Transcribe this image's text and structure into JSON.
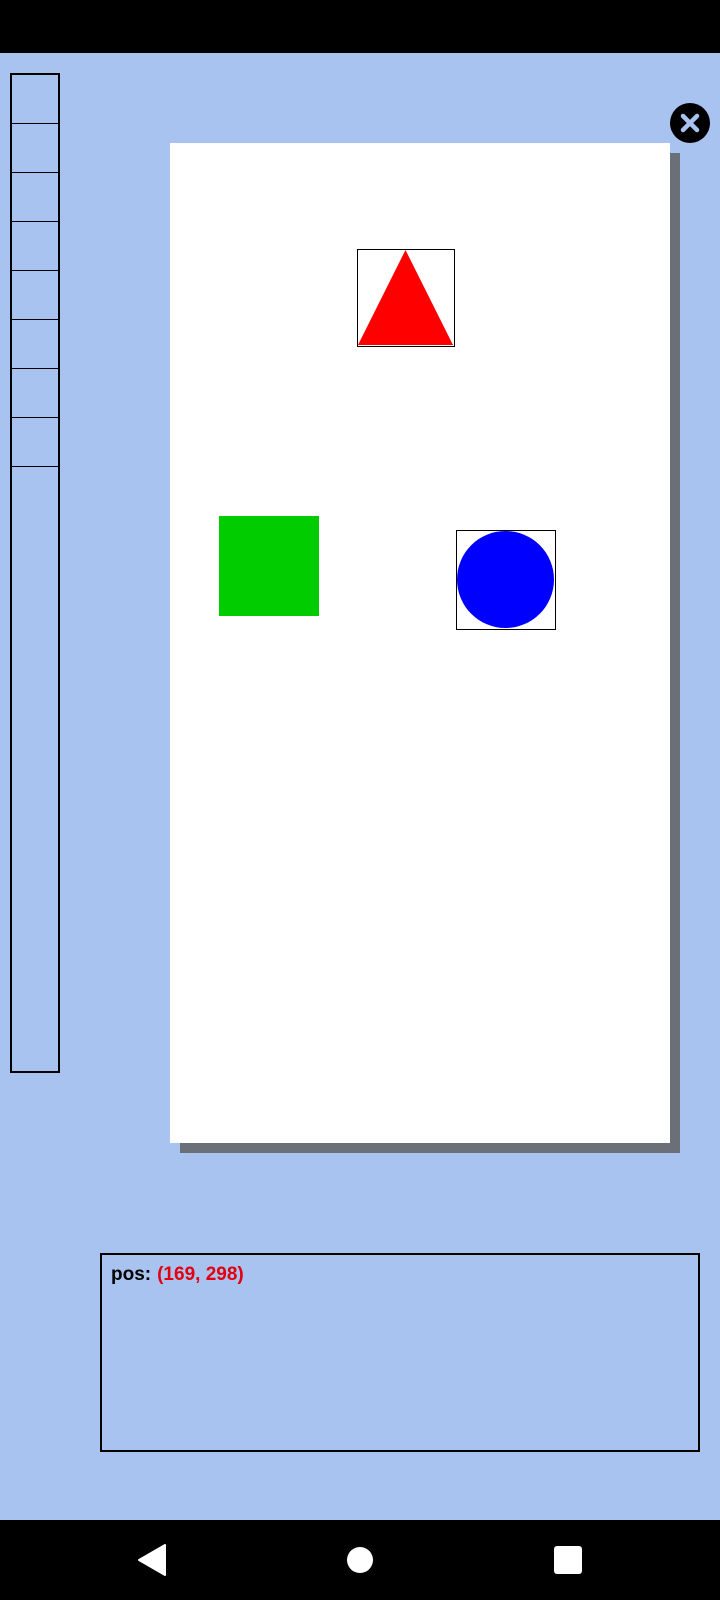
{
  "status_bar": {},
  "tool_palette": {
    "slot_count": 8
  },
  "close_button": {
    "icon": "close-icon"
  },
  "canvas": {
    "shapes": [
      {
        "name": "red-triangle",
        "color": "#ff0000",
        "framed": true
      },
      {
        "name": "green-square",
        "color": "#00cc00",
        "framed": false
      },
      {
        "name": "blue-circle",
        "color": "#0000ff",
        "framed": true
      }
    ]
  },
  "info_panel": {
    "pos_label": "pos:",
    "pos_value": "(169, 298)"
  },
  "nav_bar": {
    "back_icon": "back-triangle-icon",
    "home_icon": "home-circle-icon",
    "recents_icon": "recents-square-icon"
  }
}
